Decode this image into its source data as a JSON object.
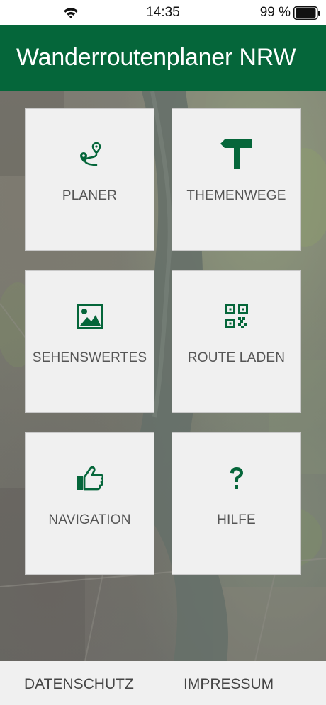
{
  "status_bar": {
    "time": "14:35",
    "battery_percent": "99 %",
    "icons": [
      "wifi-icon",
      "battery-icon"
    ]
  },
  "header": {
    "title": "Wanderroutenplaner NRW",
    "background_color": "#05663a"
  },
  "tiles": [
    {
      "label": "PLANER",
      "icon": "route-pin-icon"
    },
    {
      "label": "THEMENWEGE",
      "icon": "signpost-icon"
    },
    {
      "label": "SEHENSWERTES",
      "icon": "image-icon"
    },
    {
      "label": "ROUTE LADEN",
      "icon": "qr-code-icon"
    },
    {
      "label": "NAVIGATION",
      "icon": "thumbs-up-icon"
    },
    {
      "label": "HILFE",
      "icon": "question-mark-icon"
    }
  ],
  "footer": {
    "privacy_label": "DATENSCHUTZ",
    "imprint_label": "IMPRESSUM"
  },
  "colors": {
    "accent": "#05663a",
    "tile_background": "#f0f0f0",
    "tile_text": "#555555"
  }
}
